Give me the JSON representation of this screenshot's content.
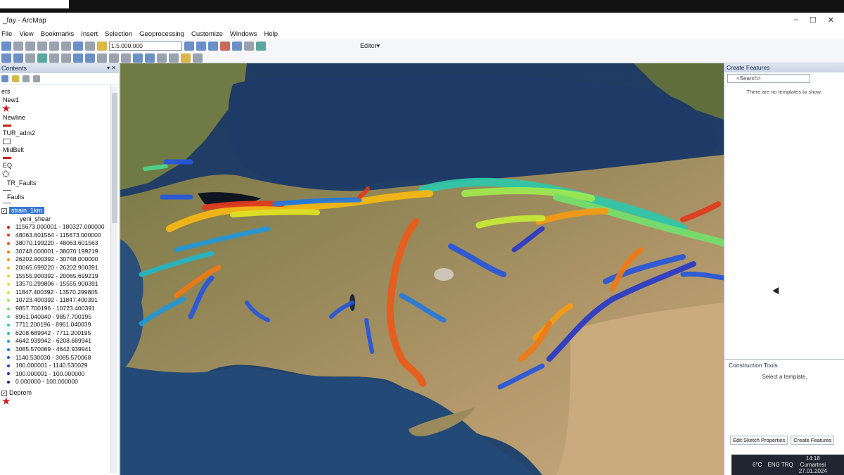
{
  "window": {
    "title": "_fay - ArcMap",
    "controls": [
      "–",
      "☐",
      "✕"
    ]
  },
  "menu": [
    "File",
    "View",
    "Bookmarks",
    "Insert",
    "Selection",
    "Geoprocessing",
    "Customize",
    "Windows",
    "Help"
  ],
  "toolbar": {
    "scale": "1:5.000.000",
    "editor": "Editor▾"
  },
  "toc": {
    "title": "Contents",
    "layers_heading": "ers",
    "layers": [
      {
        "name": "New1"
      },
      {
        "name": "Newline"
      },
      {
        "name": "TUR_adm2"
      },
      {
        "name": "MidBelt"
      },
      {
        "name": "EQ"
      },
      {
        "name": "TR_Faults"
      },
      {
        "name": "Faults"
      }
    ],
    "selected_layer": "strain_1km",
    "field": "yeni_shear",
    "legend": [
      {
        "range": "115673.000001 - 180327.000000",
        "color": "#d42020"
      },
      {
        "range": "48063.601564 - 115673.000000",
        "color": "#e03a1c"
      },
      {
        "range": "38070.199220 - 48063.601563",
        "color": "#ea5a18"
      },
      {
        "range": "30748.000001 - 38070.199219",
        "color": "#f07a14"
      },
      {
        "range": "26202.900392 - 30748.000000",
        "color": "#f59a12"
      },
      {
        "range": "20065.699220 - 26202.900391",
        "color": "#f6b812"
      },
      {
        "range": "15555.900392 - 20065.699219",
        "color": "#f2d21a"
      },
      {
        "range": "13570.299806 - 15555.900391",
        "color": "#e2e424"
      },
      {
        "range": "11847.400392 - 13570.299805",
        "color": "#c6ea36"
      },
      {
        "range": "10723.400392 - 11847.400391",
        "color": "#a0e84e"
      },
      {
        "range": "9857.700196 - 10723.400391",
        "color": "#74e06c"
      },
      {
        "range": "8961.040040 - 9857.700195",
        "color": "#4cd68c"
      },
      {
        "range": "7711.200196 - 8961.040039",
        "color": "#2ec8aa"
      },
      {
        "range": "6208.689942 - 7711.200195",
        "color": "#22b6c4"
      },
      {
        "range": "4642.939942 - 6208.689941",
        "color": "#2298d8"
      },
      {
        "range": "3085.570069 - 4642.939941",
        "color": "#2478e0"
      },
      {
        "range": "1140.530030 - 3085.570068",
        "color": "#2656dc"
      },
      {
        "range": "100.000001 - 1140.530029",
        "color": "#2838c8"
      },
      {
        "range": "100.000001 - 100.000000",
        "color": "#2a24b0"
      },
      {
        "range": "0.000000 - 100.000000",
        "color": "#241a90"
      }
    ],
    "last_layer": "Deprem"
  },
  "create_features": {
    "title": "Create Features",
    "search_placeholder": "<Search>",
    "empty_message": "There are no templates to show.",
    "construction_title": "Construction Tools",
    "construction_message": "Select a template.",
    "tabs": [
      "Edit Sketch Properties",
      "Create Features"
    ]
  },
  "taskbar": {
    "temperature": "6°C",
    "language": "ENG TRQ",
    "time": "14:18",
    "day": "Cumartesi",
    "date": "27.01.2024"
  }
}
